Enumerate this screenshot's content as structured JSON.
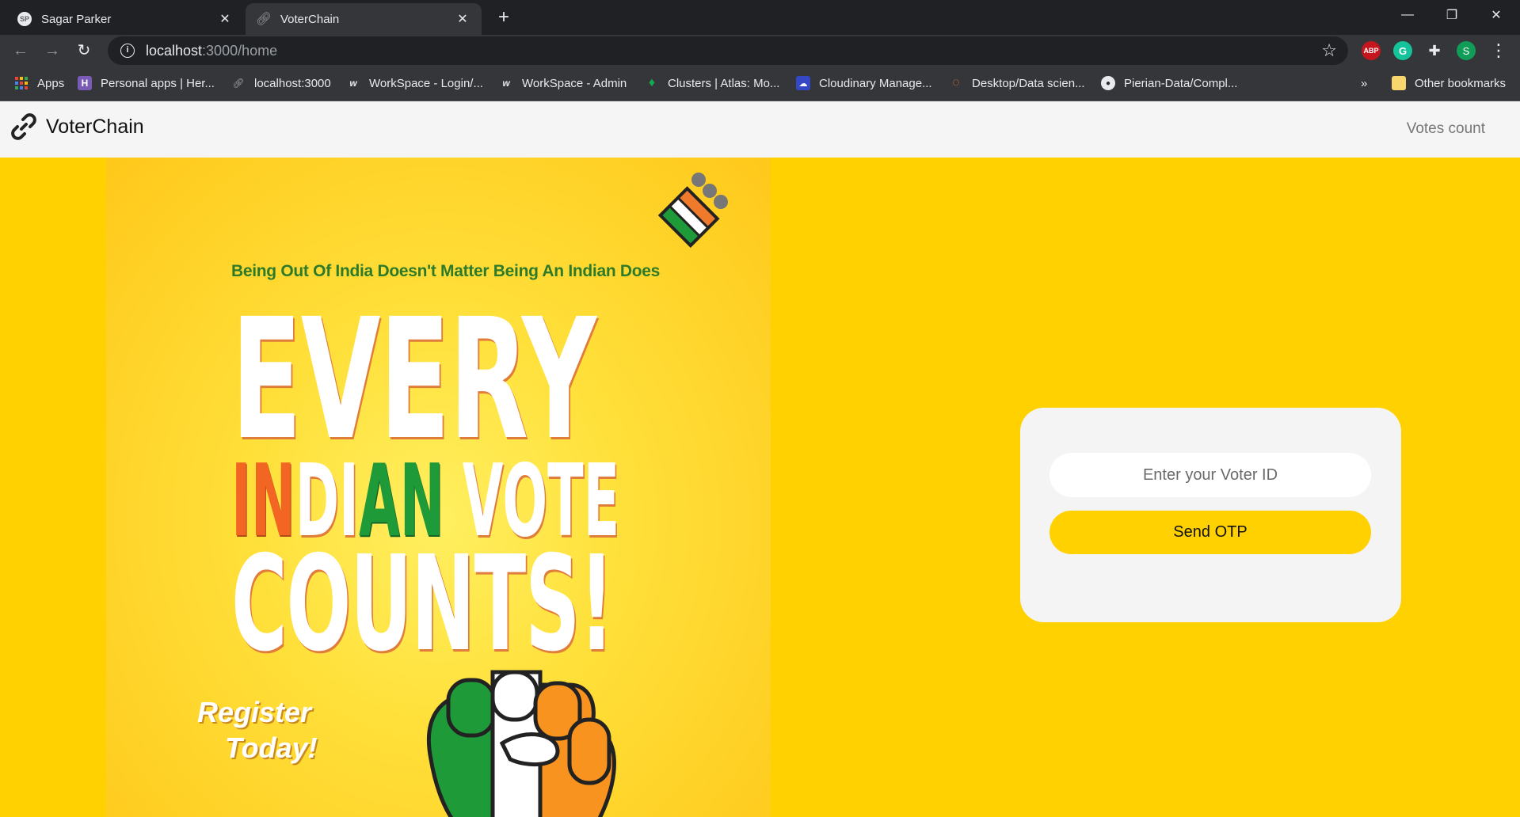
{
  "browser": {
    "tabs": [
      {
        "title": "Sagar Parker",
        "favicon": "profile-icon",
        "active": false
      },
      {
        "title": "VoterChain",
        "favicon": "link-icon",
        "active": true
      }
    ],
    "new_tab_label": "+",
    "url": {
      "host": "localhost",
      "path": ":3000/home"
    },
    "extensions": [
      {
        "name": "adblock-plus-icon",
        "label": "ABP",
        "color": "#c4161c"
      },
      {
        "name": "grammarly-icon",
        "label": "G",
        "color": "#15c39a"
      },
      {
        "name": "extensions-puzzle-icon",
        "label": "",
        "color": "#35363a"
      },
      {
        "name": "profile-avatar-icon",
        "label": "S",
        "color": "#0f9d58"
      }
    ],
    "bookmarks": [
      {
        "label": "Apps",
        "icon": "apps-grid-icon"
      },
      {
        "label": "Personal apps | Her...",
        "icon": "heroku-icon"
      },
      {
        "label": "localhost:3000",
        "icon": "link-icon"
      },
      {
        "label": "WorkSpace - Login/...",
        "icon": "workspace-icon"
      },
      {
        "label": "WorkSpace - Admin",
        "icon": "workspace-icon"
      },
      {
        "label": "Clusters | Atlas: Mo...",
        "icon": "mongodb-leaf-icon"
      },
      {
        "label": "Cloudinary Manage...",
        "icon": "cloudinary-icon"
      },
      {
        "label": "Desktop/Data scien...",
        "icon": "jupyter-icon"
      },
      {
        "label": "Pierian-Data/Compl...",
        "icon": "github-icon"
      }
    ],
    "bookmarks_overflow": "»",
    "other_bookmarks": "Other bookmarks"
  },
  "header": {
    "brand": "VoterChain",
    "nav_link": "Votes count"
  },
  "poster": {
    "tagline": "Being Out Of India Doesn't Matter Being An Indian Does",
    "line1": "EVERY",
    "line2_part1": "IN",
    "line2_part2": "DI",
    "line2_part3": "AN",
    "line2_part4": " VOTE",
    "line3": "COUNTS!",
    "register_line1": "Register",
    "register_line2": "Today!"
  },
  "login": {
    "voter_id_placeholder": "Enter your Voter ID",
    "voter_id_value": "",
    "send_otp_label": "Send OTP"
  },
  "colors": {
    "accent_yellow": "#ffd100",
    "header_bg": "#f5f5f5",
    "card_bg": "#f4f4f4",
    "saffron": "#f26522",
    "green": "#1f9a39"
  }
}
